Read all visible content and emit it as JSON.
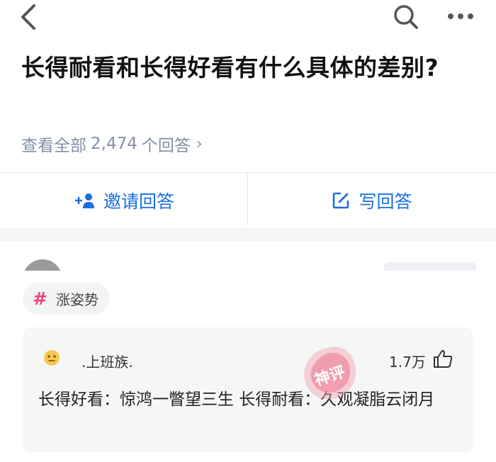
{
  "header": {
    "back_icon": "chevron-left-icon",
    "search_icon": "search-icon",
    "more_icon": "more-horizontal-icon"
  },
  "question": {
    "title": "长得耐看和长得好看有什么具体的差别?",
    "answers_prefix": "查看全部",
    "answers_count": "2,474",
    "answers_suffix": "个回答"
  },
  "actions": {
    "invite_label": "邀请回答",
    "write_label": "写回答",
    "accent_color": "#1a6fe0"
  },
  "tag": {
    "label": "涨姿势",
    "hash_color": "#f0447c"
  },
  "comment": {
    "username": ".上班族.",
    "avatar_icon": "emoji-face-icon",
    "likes": "1.7万",
    "like_icon": "thumbs-up-icon",
    "text": "长得好看：惊鸿一瞥望三生 长得耐看：久观凝脂云闭月"
  },
  "watermark": {
    "text": "神评"
  }
}
